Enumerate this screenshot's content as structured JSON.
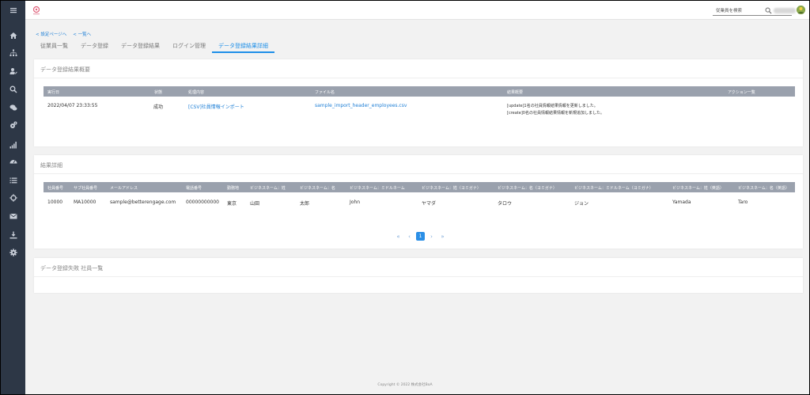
{
  "topbar": {
    "search_placeholder": "従業員を検索"
  },
  "breadcrumb": {
    "back_settings": "< 設定ページへ",
    "back_list": "< 一覧へ"
  },
  "tabs": [
    {
      "label": "従業員一覧"
    },
    {
      "label": "データ登録"
    },
    {
      "label": "データ登録結果"
    },
    {
      "label": "ログイン管理"
    },
    {
      "label": "データ登録結果詳細",
      "active": true
    }
  ],
  "summary": {
    "title": "データ登録結果概要",
    "headers": {
      "run_date": "実行日",
      "status": "状態",
      "process": "処理内容",
      "file": "ファイル名",
      "result": "結果概要",
      "actions": "アクション一覧"
    },
    "row": {
      "run_date": "2022/04/07 23:33:55",
      "status": "成功",
      "process": "[CSV]社員情報インポート",
      "file": "sample_import_header_employees.csv",
      "result_line1": "[update]1名の社員情報結果情報を更新しました。",
      "result_line2": "[create]0名の社員情報結果情報を新規追加しました。"
    }
  },
  "detail": {
    "title": "結果詳細",
    "headers": [
      "社員番号",
      "サブ社員番号",
      "メールアドレス",
      "電話番号",
      "勤務地",
      "ビジネスネーム：姓",
      "ビジネスネーム：名",
      "ビジネスネーム：ミドルネーム",
      "ビジネスネーム：姓（ヨミガナ）",
      "ビジネスネーム：名（ヨミガナ）",
      "ビジネスネーム：ミドルネーム（ヨミガナ）",
      "ビジネスネーム：姓（英語）",
      "ビジネスネーム：名（英語）"
    ],
    "row": [
      "10000",
      "MA10000",
      "sample@betterengage.com",
      "00000000000",
      "東京",
      "山田",
      "太郎",
      "John",
      "ヤマダ",
      "タロウ",
      "ジョン",
      "Yamada",
      "Taro"
    ]
  },
  "pagination": {
    "first": "«",
    "prev": "‹",
    "current": "1",
    "next": "›",
    "last": "»"
  },
  "failed": {
    "title": "データ登録失敗 社員一覧"
  },
  "footer": {
    "copyright": "Copyright © 2022 株式会社BoA"
  },
  "sidebar": {
    "icons": [
      "menu-icon",
      "home-icon",
      "org-chart-icon",
      "user-edit-icon",
      "search-icon",
      "chat-icon",
      "settings-gears-icon",
      "bar-chart-icon",
      "dashboard-icon",
      "list-icon",
      "crosshair-icon",
      "mail-icon",
      "download-icon",
      "gear-icon"
    ]
  },
  "colors": {
    "sidebar": "#2d3746",
    "accent": "#1e8fe8",
    "table_header": "#9aa1ad"
  }
}
